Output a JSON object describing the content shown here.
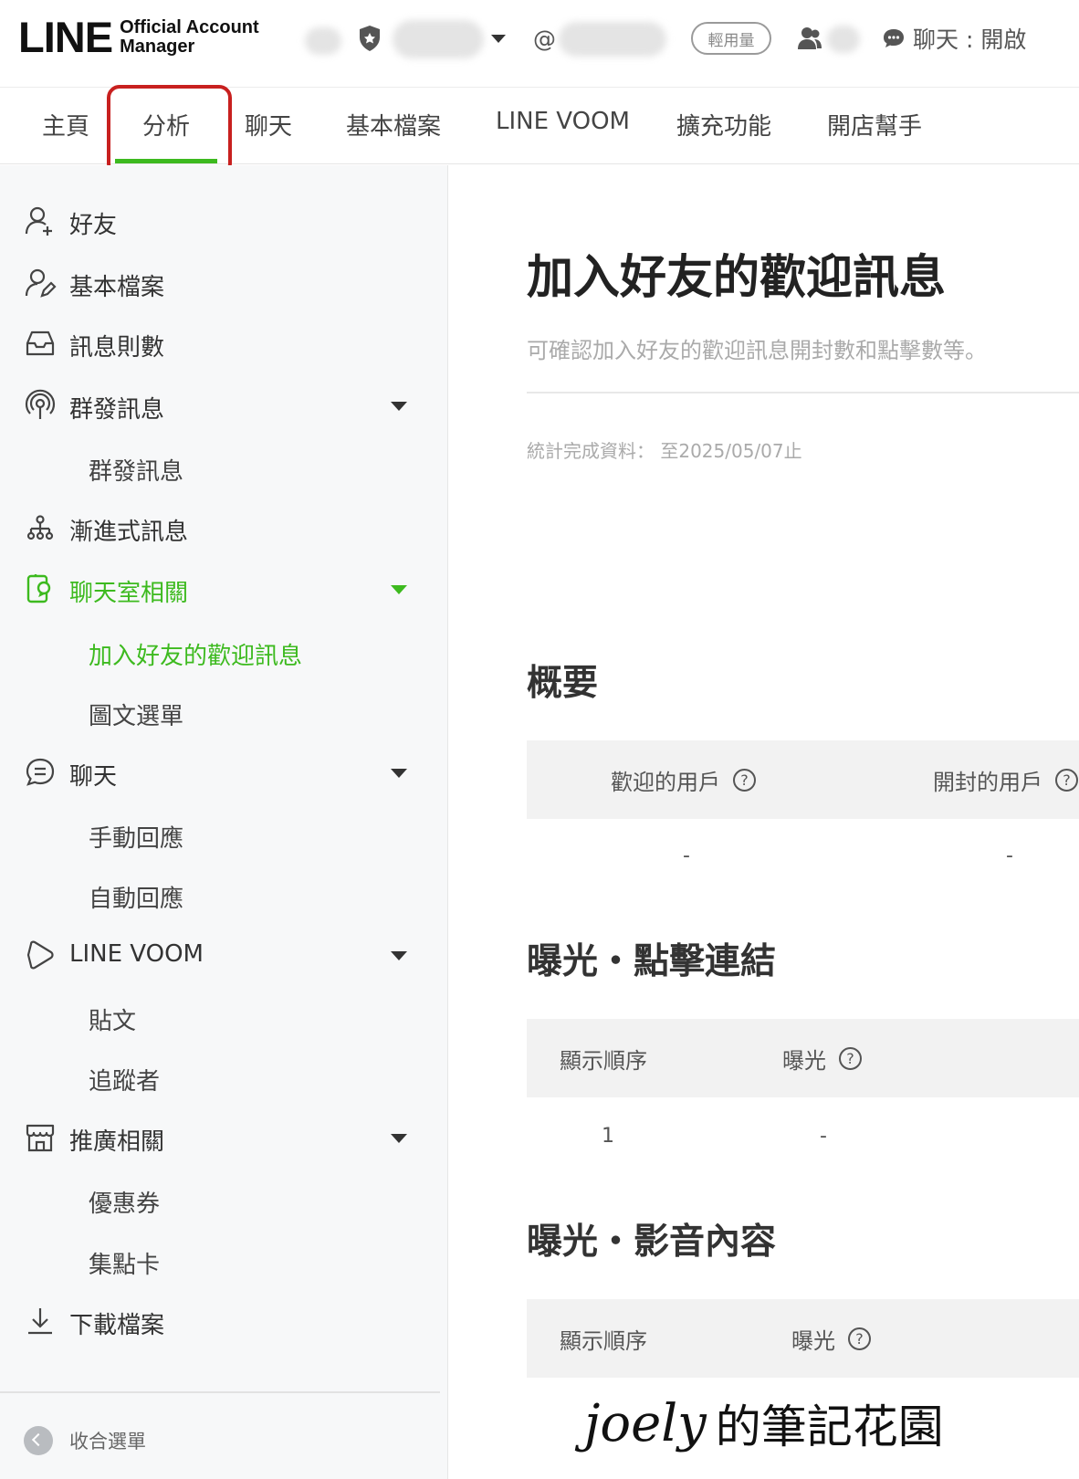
{
  "header": {
    "logo_main": "LINE",
    "logo_sub_1": "Official Account",
    "logo_sub_2": "Manager",
    "at_symbol": "@",
    "usage_badge": "輕用量",
    "chat_status": "聊天 : 開啟"
  },
  "tabs": [
    {
      "label": "主頁"
    },
    {
      "label": "分析"
    },
    {
      "label": "聊天"
    },
    {
      "label": "基本檔案"
    },
    {
      "label": "LINE VOOM"
    },
    {
      "label": "擴充功能"
    },
    {
      "label": "開店幫手"
    }
  ],
  "active_tab": "分析",
  "sidebar": {
    "friends": "好友",
    "profile": "基本檔案",
    "message_count": "訊息則數",
    "broadcast": "群發訊息",
    "broadcast_sub": "群發訊息",
    "step_message": "漸進式訊息",
    "chatroom": "聊天室相關",
    "welcome_message": "加入好友的歡迎訊息",
    "rich_menu": "圖文選單",
    "chat": "聊天",
    "manual_reply": "手動回應",
    "auto_reply": "自動回應",
    "voom": "LINE VOOM",
    "posts": "貼文",
    "followers": "追蹤者",
    "promotion": "推廣相關",
    "coupon": "優惠券",
    "reward_card": "集點卡",
    "download": "下載檔案",
    "collapse": "收合選單"
  },
  "main": {
    "title": "加入好友的歡迎訊息",
    "subtitle": "可確認加入好友的歡迎訊息開封數和點擊數等。",
    "stat_date": "統計完成資料： 至2025/05/07止",
    "overview": {
      "title": "概要",
      "col1": "歡迎的用戶",
      "col2": "開封的用戶",
      "val1": "-",
      "val2": "-"
    },
    "link_section": {
      "title": "曝光・點擊連結",
      "col1": "顯示順序",
      "col2": "曝光",
      "row_order": "1",
      "row_impressions": "-"
    },
    "video_section": {
      "title": "曝光・影音內容",
      "col1": "顯示順序",
      "col2": "曝光"
    },
    "help_glyph": "?"
  },
  "watermark": {
    "script": "joely",
    "text": "的筆記花園"
  },
  "colors": {
    "accent_green": "#3dba1f",
    "highlight_red": "#c8201f"
  }
}
